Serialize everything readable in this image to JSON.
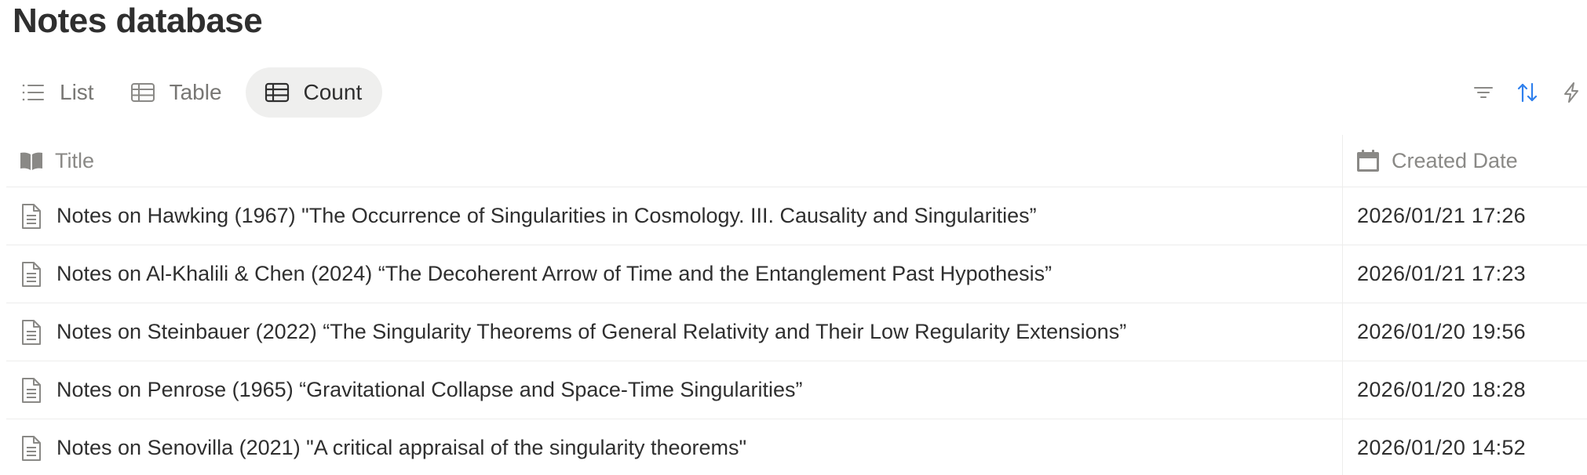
{
  "page": {
    "title": "Notes database"
  },
  "views": [
    {
      "label": "List",
      "icon": "list-icon",
      "active": false
    },
    {
      "label": "Table",
      "icon": "table-icon",
      "active": false
    },
    {
      "label": "Count",
      "icon": "table-icon",
      "active": true
    }
  ],
  "toolbar": {
    "icons": [
      "filter-icon",
      "sort-icon",
      "automation-icon"
    ],
    "sort_active_color": "#2f80ed"
  },
  "table": {
    "columns": [
      {
        "label": "Title",
        "icon": "book-icon"
      },
      {
        "label": "Created Date",
        "icon": "calendar-icon"
      }
    ],
    "rows": [
      {
        "title": "Notes on Hawking (1967) \"The Occurrence of Singularities in Cosmology. III. Causality and Singularities”",
        "created": "2026/01/21 17:26"
      },
      {
        "title": "Notes on Al-Khalili & Chen (2024) “The Decoherent Arrow of Time and the Entanglement Past Hypothesis”",
        "created": "2026/01/21 17:23"
      },
      {
        "title": "Notes on Steinbauer (2022) “The Singularity Theorems of General Relativity and Their Low Regularity Extensions”",
        "created": "2026/01/20 19:56"
      },
      {
        "title": "Notes on Penrose (1965) “Gravitational Collapse and Space-Time Singularities”",
        "created": "2026/01/20 18:28"
      },
      {
        "title": "Notes on Senovilla (2021) \"A critical appraisal of the singularity theorems\"",
        "created": "2026/01/20 14:52"
      }
    ]
  },
  "colors": {
    "text": "#2f2f2f",
    "muted": "#787774",
    "divider": "#ededec",
    "active_tab_bg": "#efefee"
  }
}
